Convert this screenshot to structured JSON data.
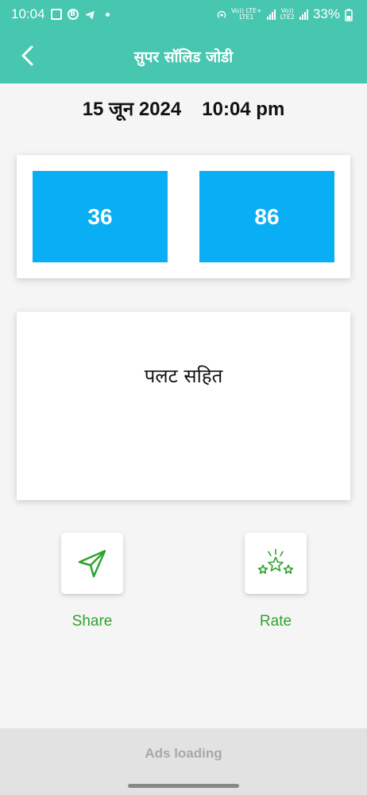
{
  "status_bar": {
    "time": "10:04",
    "net_sim1": "Vo)) LTE+",
    "net_sim1_sub": "LTE1",
    "net_sim2": "Vo))",
    "net_sim2_sub": "LTE2",
    "battery": "33%",
    "icons": [
      "image-icon",
      "b-app-icon",
      "telegram-icon",
      "dot-icon",
      "hotspot-icon",
      "signal-icon",
      "battery-icon"
    ]
  },
  "app_bar": {
    "title": "सुपर सॉलिड जोडी",
    "back_icon": "chevron-left-icon"
  },
  "date_row": {
    "date": "15 जून 2024",
    "time": "10:04 pm"
  },
  "numbers": [
    "36",
    "86"
  ],
  "info_card": {
    "text": "पलट सहित"
  },
  "actions": {
    "share_label": "Share",
    "rate_label": "Rate"
  },
  "ads": {
    "text": "Ads loading"
  },
  "colors": {
    "primary": "#47c6b0",
    "number_box": "#0aaef5",
    "action_green": "#2ea32e"
  }
}
